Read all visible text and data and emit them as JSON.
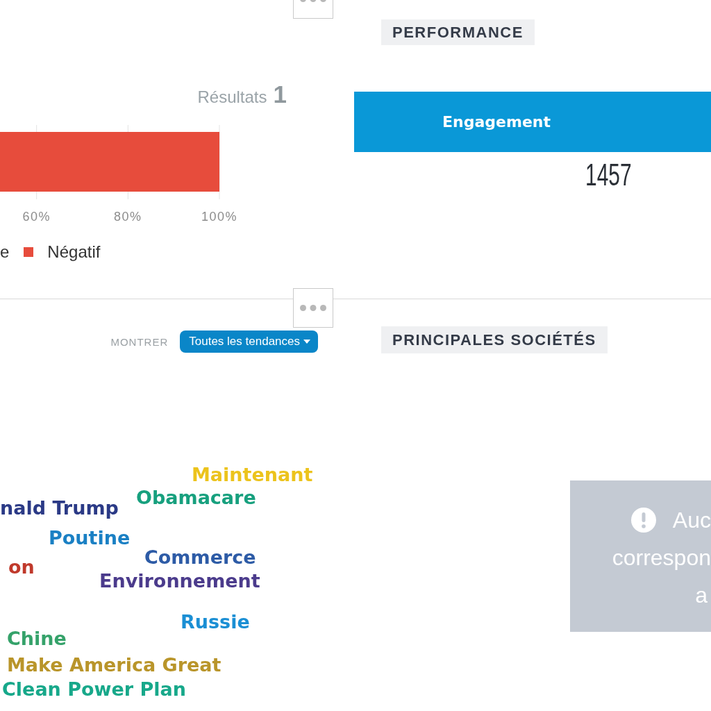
{
  "sentiment": {
    "results_label": "Résultats",
    "results_count": "1",
    "chart_data": {
      "type": "bar",
      "orientation": "horizontal",
      "grid": true,
      "xlim": [
        52,
        100
      ],
      "xticks": [
        {
          "value": 60,
          "label": "60%"
        },
        {
          "value": 80,
          "label": "80%"
        },
        {
          "value": 100,
          "label": "100%"
        }
      ],
      "series": [
        {
          "name": "e",
          "values": [
            null
          ]
        },
        {
          "name": "Négatif",
          "color": "#e74c3c",
          "values": [
            100
          ]
        }
      ]
    }
  },
  "performance": {
    "title": "PERFORMANCE",
    "metrics": [
      {
        "label": "Engagement",
        "value": "1457"
      }
    ]
  },
  "trends": {
    "show_label": "MONTRER",
    "filter": "Toutes les tendances",
    "word_cloud": [
      {
        "text": "Maintenant",
        "color": "#ecc31c"
      },
      {
        "text": "Obamacare",
        "color": "#17a07e"
      },
      {
        "text": "nald Trump",
        "color": "#2b3a86"
      },
      {
        "text": "Poutine",
        "color": "#1a80c4"
      },
      {
        "text": "Commerce",
        "color": "#2d5ba6"
      },
      {
        "text": "on",
        "color": "#c0392b"
      },
      {
        "text": "Environnement",
        "color": "#4b3b8c"
      },
      {
        "text": "Russie",
        "color": "#1b8fd4"
      },
      {
        "text": "Chine",
        "color": "#35a26a"
      },
      {
        "text": "Make America Great",
        "color": "#b9952a"
      },
      {
        "text": "Clean Power Plan",
        "color": "#17a88a"
      }
    ]
  },
  "top_companies": {
    "title": "PRINCIPALES SOCIÉTÉS",
    "notice_lines": [
      "Auc",
      "correspon",
      "a"
    ]
  }
}
